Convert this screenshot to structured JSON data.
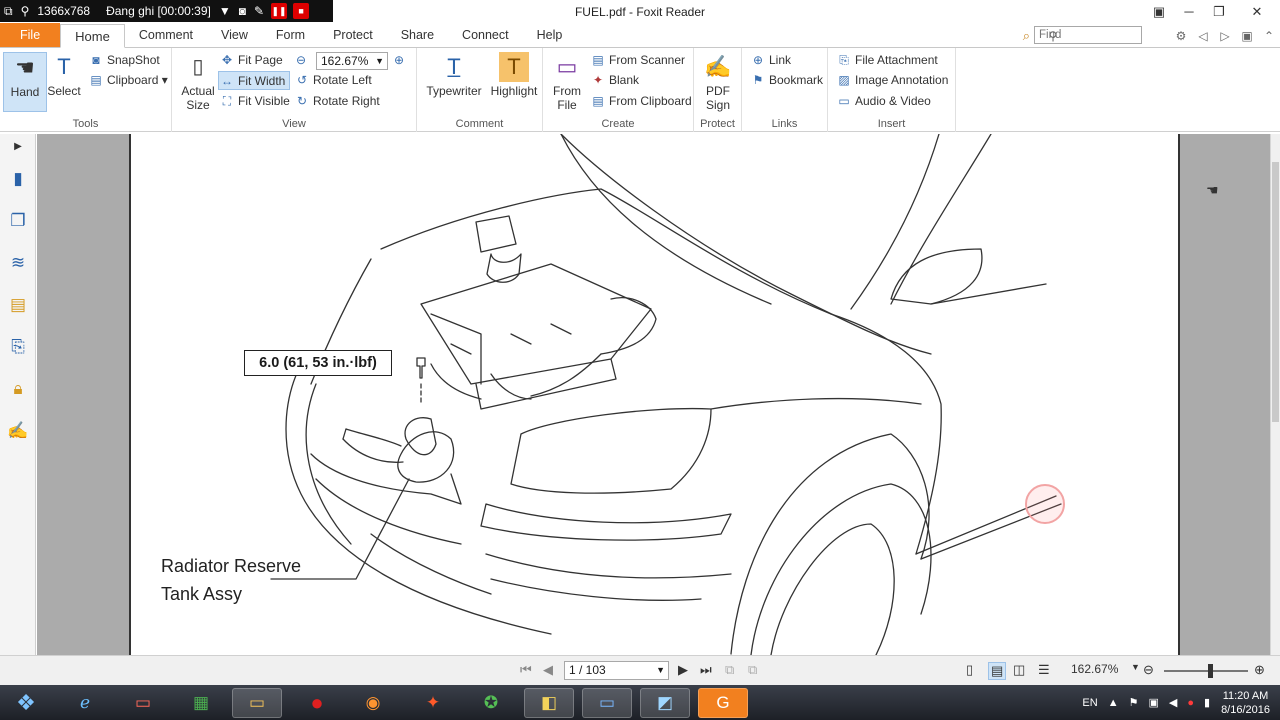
{
  "recorder": {
    "resolution": "1366x768",
    "status": "Đang ghi [00:00:39]"
  },
  "window": {
    "title": "FUEL.pdf - Foxit Reader"
  },
  "menu": {
    "tabs": [
      "File",
      "Home",
      "Comment",
      "View",
      "Form",
      "Protect",
      "Share",
      "Connect",
      "Help"
    ],
    "find_placeholder": "Find"
  },
  "ribbon": {
    "tools": {
      "label": "Tools",
      "hand": "Hand",
      "select": "Select",
      "snapshot": "SnapShot",
      "clipboard": "Clipboard"
    },
    "view": {
      "label": "View",
      "actual_size_1": "Actual",
      "actual_size_2": "Size",
      "fit_page": "Fit Page",
      "fit_width": "Fit Width",
      "fit_visible": "Fit Visible",
      "rotate_left": "Rotate Left",
      "rotate_right": "Rotate Right",
      "zoom_value": "162.67%"
    },
    "comment": {
      "label": "Comment",
      "typewriter": "Typewriter",
      "highlight": "Highlight"
    },
    "create": {
      "label": "Create",
      "from_file_1": "From",
      "from_file_2": "File",
      "from_scanner": "From Scanner",
      "blank": "Blank",
      "from_clipboard": "From Clipboard"
    },
    "protect": {
      "label": "Protect",
      "pdf_sign_1": "PDF",
      "pdf_sign_2": "Sign"
    },
    "links": {
      "label": "Links",
      "link": "Link",
      "bookmark": "Bookmark"
    },
    "insert": {
      "label": "Insert",
      "file_attachment": "File Attachment",
      "image_annotation": "Image Annotation",
      "audio_video": "Audio & Video"
    }
  },
  "document": {
    "torque_label": "6.0 (61, 53 in.·lbf)",
    "part_label_1": "Radiator Reserve",
    "part_label_2": "Tank Assy"
  },
  "status": {
    "page_display": "1 / 103",
    "zoom": "162.67%"
  },
  "taskbar": {
    "language": "EN",
    "time": "11:20 AM",
    "date": "8/16/2016"
  },
  "colors": {
    "file_tab": "#f2801f",
    "selected": "#cfe4f7",
    "doc_background": "#ababab"
  }
}
